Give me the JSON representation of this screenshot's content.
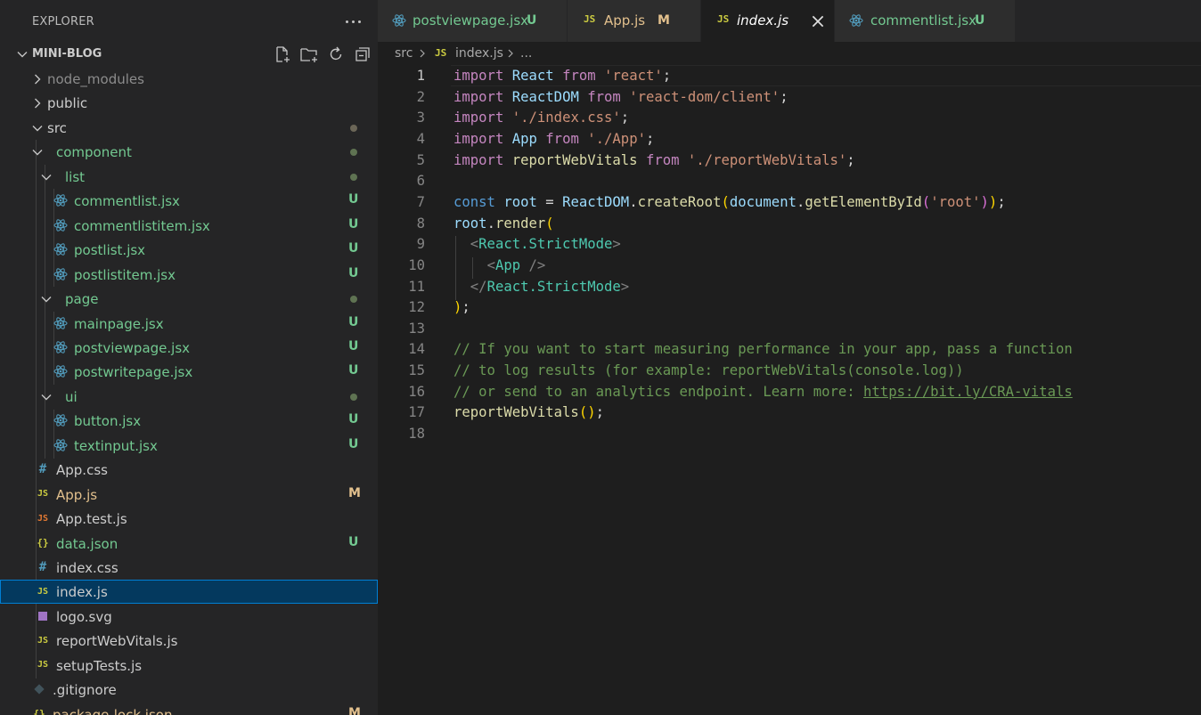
{
  "sidebar": {
    "title": "EXPLORER",
    "project": "MINI-BLOG",
    "items": [
      {
        "name": "node_modules",
        "kind": "folder-closed",
        "depth": 0,
        "color": "#8c8c8c"
      },
      {
        "name": "public",
        "kind": "folder-closed",
        "depth": 0,
        "color": "#cccccc"
      },
      {
        "name": "src",
        "kind": "folder-open",
        "depth": 0,
        "color": "#cccccc",
        "dot": "gray"
      },
      {
        "name": "component",
        "kind": "folder-open",
        "depth": 1,
        "color": "#73c991",
        "dot": "green"
      },
      {
        "name": "list",
        "kind": "folder-open",
        "depth": 2,
        "color": "#73c991",
        "dot": "green"
      },
      {
        "name": "commentlist.jsx",
        "kind": "react",
        "depth": 3,
        "color": "#73c991",
        "badge": "U"
      },
      {
        "name": "commentlistitem.jsx",
        "kind": "react",
        "depth": 3,
        "color": "#73c991",
        "badge": "U"
      },
      {
        "name": "postlist.jsx",
        "kind": "react",
        "depth": 3,
        "color": "#73c991",
        "badge": "U"
      },
      {
        "name": "postlistitem.jsx",
        "kind": "react",
        "depth": 3,
        "color": "#73c991",
        "badge": "U"
      },
      {
        "name": "page",
        "kind": "folder-open",
        "depth": 2,
        "color": "#73c991",
        "dot": "green"
      },
      {
        "name": "mainpage.jsx",
        "kind": "react",
        "depth": 3,
        "color": "#73c991",
        "badge": "U"
      },
      {
        "name": "postviewpage.jsx",
        "kind": "react",
        "depth": 3,
        "color": "#73c991",
        "badge": "U"
      },
      {
        "name": "postwritepage.jsx",
        "kind": "react",
        "depth": 3,
        "color": "#73c991",
        "badge": "U"
      },
      {
        "name": "ui",
        "kind": "folder-open",
        "depth": 2,
        "color": "#73c991",
        "dot": "green"
      },
      {
        "name": "button.jsx",
        "kind": "react",
        "depth": 3,
        "color": "#73c991",
        "badge": "U"
      },
      {
        "name": "textinput.jsx",
        "kind": "react",
        "depth": 3,
        "color": "#73c991",
        "badge": "U"
      },
      {
        "name": "App.css",
        "kind": "css",
        "depth": 1,
        "color": "#cccccc"
      },
      {
        "name": "App.js",
        "kind": "js",
        "depth": 1,
        "color": "#e2c08d",
        "badge": "M"
      },
      {
        "name": "App.test.js",
        "kind": "jstest",
        "depth": 1,
        "color": "#cccccc"
      },
      {
        "name": "data.json",
        "kind": "json",
        "depth": 1,
        "color": "#73c991",
        "badge": "U"
      },
      {
        "name": "index.css",
        "kind": "css",
        "depth": 1,
        "color": "#cccccc"
      },
      {
        "name": "index.js",
        "kind": "js",
        "depth": 1,
        "color": "#cccccc",
        "selected": true
      },
      {
        "name": "logo.svg",
        "kind": "svg",
        "depth": 1,
        "color": "#cccccc"
      },
      {
        "name": "reportWebVitals.js",
        "kind": "js",
        "depth": 1,
        "color": "#cccccc"
      },
      {
        "name": "setupTests.js",
        "kind": "js",
        "depth": 1,
        "color": "#cccccc"
      },
      {
        "name": ".gitignore",
        "kind": "git",
        "depth": 0,
        "color": "#cccccc"
      },
      {
        "name": "package-lock.json",
        "kind": "json",
        "depth": 0,
        "color": "#e2c08d",
        "badge": "M"
      }
    ]
  },
  "tabs": [
    {
      "label": "postviewpage.jsx",
      "icon": "react",
      "badge": "U",
      "color": "#73c991",
      "active": false
    },
    {
      "label": "App.js",
      "icon": "js",
      "badge": "M",
      "color": "#e2c08d",
      "active": false
    },
    {
      "label": "index.js",
      "icon": "js",
      "badge": "",
      "color": "#ffffff",
      "active": true
    },
    {
      "label": "commentlist.jsx",
      "icon": "react",
      "badge": "U",
      "color": "#73c991",
      "active": false
    }
  ],
  "breadcrumb": {
    "folder": "src",
    "file": "index.js",
    "more": "..."
  },
  "editor": {
    "current_line": 1,
    "lines": [
      "import React from 'react';",
      "import ReactDOM from 'react-dom/client';",
      "import './index.css';",
      "import App from './App';",
      "import reportWebVitals from './reportWebVitals';",
      "",
      "const root = ReactDOM.createRoot(document.getElementById('root'));",
      "root.render(",
      "  <React.StrictMode>",
      "    <App />",
      "  </React.StrictMode>",
      ");",
      "",
      "// If you want to start measuring performance in your app, pass a function",
      "// to log results (for example: reportWebVitals(console.log))",
      "// or send to an analytics endpoint. Learn more: https://bit.ly/CRA-vitals",
      "reportWebVitals();",
      ""
    ]
  },
  "colors": {
    "react_icon": "#519aba",
    "js_icon": "#cbcb41",
    "css_icon": "#519aba",
    "json_icon": "#cbcb41",
    "svg_icon": "#a074c4",
    "git_icon": "#41535b",
    "jstest_icon": "#e37933"
  }
}
